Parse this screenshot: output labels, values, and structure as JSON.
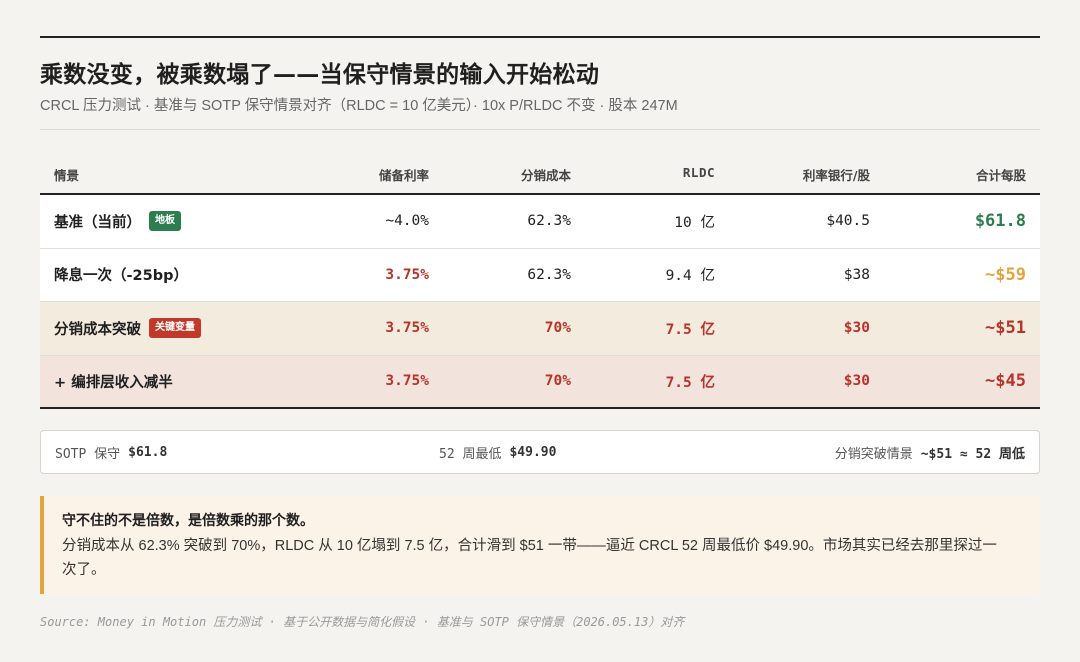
{
  "title": "乘数没变，被乘数塌了——当保守情景的输入开始松动",
  "subtitle": "CRCL 压力测试 · 基准与 SOTP 保守情景对齐（RLDC = 10 亿美元）· 10x P/RLDC 不变 · 股本 247M",
  "table": {
    "headers": [
      "情景",
      "储备利率",
      "分销成本",
      "RLDC",
      "利率银行/股",
      "合计每股"
    ],
    "rows": [
      {
        "scenario": "基准（当前）",
        "badge": "地板",
        "rate": "~4.0%",
        "dist": "62.3%",
        "rldc": "10 亿",
        "bank": "$40.5",
        "total": "$61.8"
      },
      {
        "scenario": "降息一次（-25bp）",
        "badge": "",
        "rate": "3.75%",
        "dist": "62.3%",
        "rldc": "9.4 亿",
        "bank": "$38",
        "total": "~$59"
      },
      {
        "scenario": "分销成本突破",
        "badge": "关键变量",
        "rate": "3.75%",
        "dist": "70%",
        "rldc": "7.5 亿",
        "bank": "$30",
        "total": "~$51"
      },
      {
        "scenario": "+ 编排层收入减半",
        "badge": "",
        "rate": "3.75%",
        "dist": "70%",
        "rldc": "7.5 亿",
        "bank": "$30",
        "total": "~$45"
      }
    ]
  },
  "summary": {
    "left_label": "SOTP 保守",
    "left_value": "$61.8",
    "mid_label": "52 周最低",
    "mid_value": "$49.90",
    "right_label": "分销突破情景",
    "right_value": "~$51 ≈ 52 周低"
  },
  "note": {
    "title": "守不住的不是倍数，是倍数乘的那个数。",
    "body": "分销成本从 62.3% 突破到 70%，RLDC 从 10 亿塌到 7.5 亿，合计滑到 $51 一带——逼近 CRCL 52 周最低价 $49.90。市场其实已经去那里探过一次了。"
  },
  "source": "Source: Money in Motion 压力测试 · 基于公开数据与简化假设 · 基准与 SOTP 保守情景（2026.05.13）对齐",
  "colors": {
    "green": "#2e7d4f",
    "amber": "#e3a43a",
    "orange": "#e3a43a",
    "red": "#b8332a",
    "badge_red": "#c0392b",
    "row_beige": "#f4ebdf",
    "row_pink": "#f2e3dd"
  }
}
